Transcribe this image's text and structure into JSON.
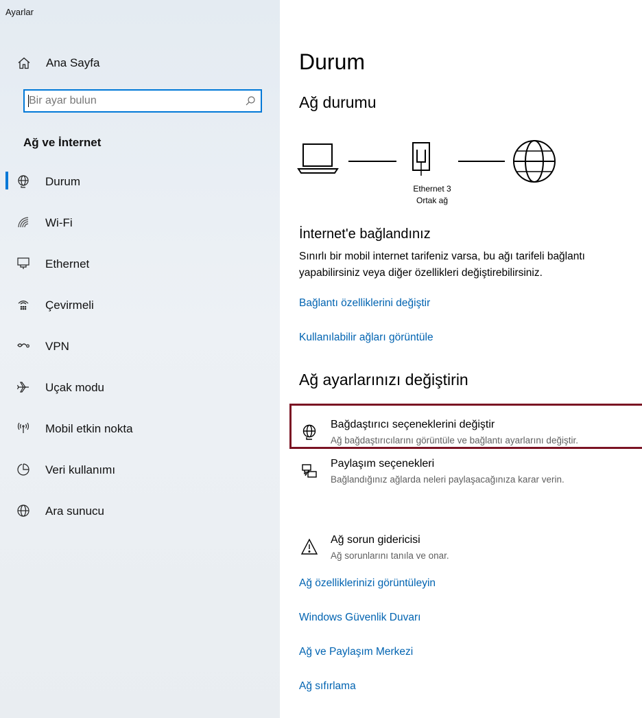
{
  "window": {
    "app_title": "Ayarlar"
  },
  "sidebar": {
    "home": {
      "label": "Ana Sayfa",
      "icon": "home-icon"
    },
    "search": {
      "placeholder": "Bir ayar bulun",
      "icon": "search-icon"
    },
    "section_title": "Ağ ve İnternet",
    "items": [
      {
        "label": "Durum",
        "icon": "globe-status-icon",
        "selected": true
      },
      {
        "label": "Wi-Fi",
        "icon": "wifi-icon",
        "selected": false
      },
      {
        "label": "Ethernet",
        "icon": "ethernet-icon",
        "selected": false
      },
      {
        "label": "Çevirmeli",
        "icon": "dialup-icon",
        "selected": false
      },
      {
        "label": "VPN",
        "icon": "vpn-icon",
        "selected": false
      },
      {
        "label": "Uçak modu",
        "icon": "airplane-icon",
        "selected": false
      },
      {
        "label": "Mobil etkin nokta",
        "icon": "hotspot-icon",
        "selected": false
      },
      {
        "label": "Veri kullanımı",
        "icon": "data-usage-icon",
        "selected": false
      },
      {
        "label": "Ara sunucu",
        "icon": "proxy-icon",
        "selected": false
      }
    ],
    "accent_color": "#0078d7"
  },
  "main": {
    "page_title": "Durum",
    "network_status_title": "Ağ durumu",
    "diagram": {
      "adapter_name": "Ethernet 3",
      "network_type": "Ortak ağ"
    },
    "connection_title": "İnternet'e bağlandınız",
    "connection_desc_line1": "Sınırlı bir mobil internet tarifeniz varsa, bu ağı tarifeli bağlantı",
    "connection_desc_line2": "yapabilirsiniz veya diğer özellikleri değiştirebilirsiniz.",
    "links_top": [
      {
        "label": "Bağlantı özelliklerini değiştir"
      },
      {
        "label": "Kullanılabilir ağları görüntüle"
      }
    ],
    "settings_title": "Ağ ayarlarınızı değiştirin",
    "options": [
      {
        "title": "Bağdaştırıcı seçeneklerini değiştir",
        "desc": "Ağ bağdaştırıcılarını görüntüle ve bağlantı ayarlarını değiştir.",
        "icon": "adapter-icon",
        "highlighted": true
      },
      {
        "title": "Paylaşım seçenekleri",
        "desc": "Bağlandığınız ağlarda neleri paylaşacağınıza karar verin.",
        "icon": "sharing-icon",
        "highlighted": false
      },
      {
        "title": "Ağ sorun gidericisi",
        "desc": "Ağ sorunlarını tanıla ve onar.",
        "icon": "warning-icon",
        "highlighted": false
      }
    ],
    "links_bottom": [
      {
        "label": "Ağ özelliklerinizi görüntüleyin"
      },
      {
        "label": "Windows Güvenlik Duvarı"
      },
      {
        "label": "Ağ ve Paylaşım Merkezi"
      },
      {
        "label": "Ağ sıfırlama"
      }
    ],
    "link_color": "#0063b1",
    "highlight_color": "#7a1323"
  }
}
